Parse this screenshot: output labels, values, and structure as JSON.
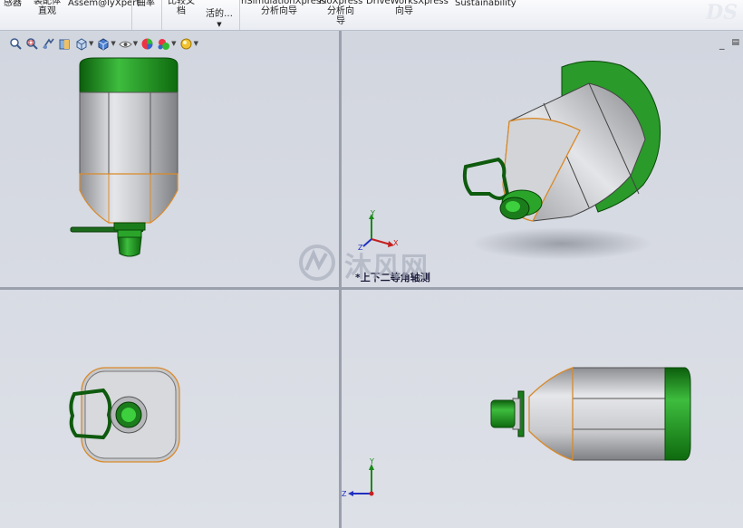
{
  "ribbon": {
    "items": [
      {
        "label": "感器"
      },
      {
        "label": "装配体\n直观"
      },
      {
        "label": "Assem@lyXpert"
      },
      {
        "label": "曲率"
      },
      {
        "label": "比较文\n档"
      },
      {
        "label": "活的…"
      },
      {
        "label": "nSimulationXpress\n分析向导"
      },
      {
        "label": "FloXpress\n分析向\n导"
      },
      {
        "label": "DriveWorksXpress\n向导"
      },
      {
        "label": "Sustainability"
      }
    ],
    "watermark": "DS"
  },
  "toolbar": {
    "icons": [
      "zoom-to-fit-icon",
      "zoom-to-area-icon",
      "previous-view-icon",
      "section-view-icon",
      "view-orientation-icon",
      "display-style-icon",
      "hide-show-items-icon",
      "edit-appearance-icon",
      "apply-scene-icon",
      "view-settings-icon"
    ]
  },
  "window_controls": {
    "minimize": "_",
    "restore": "🗗"
  },
  "viewports": {
    "top_right_label": "*上下二等角轴测"
  },
  "triad": {
    "top_right": {
      "y": "Y",
      "x": "X",
      "z": "Z"
    },
    "bottom_right": {
      "y": "Y",
      "z": "Z"
    }
  },
  "watermark_text": "沐风网",
  "colors": {
    "cap_green": "#1e8a1e",
    "body_gray": "#b8b9bc",
    "edge_orange": "#d98a2b",
    "viewport_bg": "#d6d9e1"
  }
}
